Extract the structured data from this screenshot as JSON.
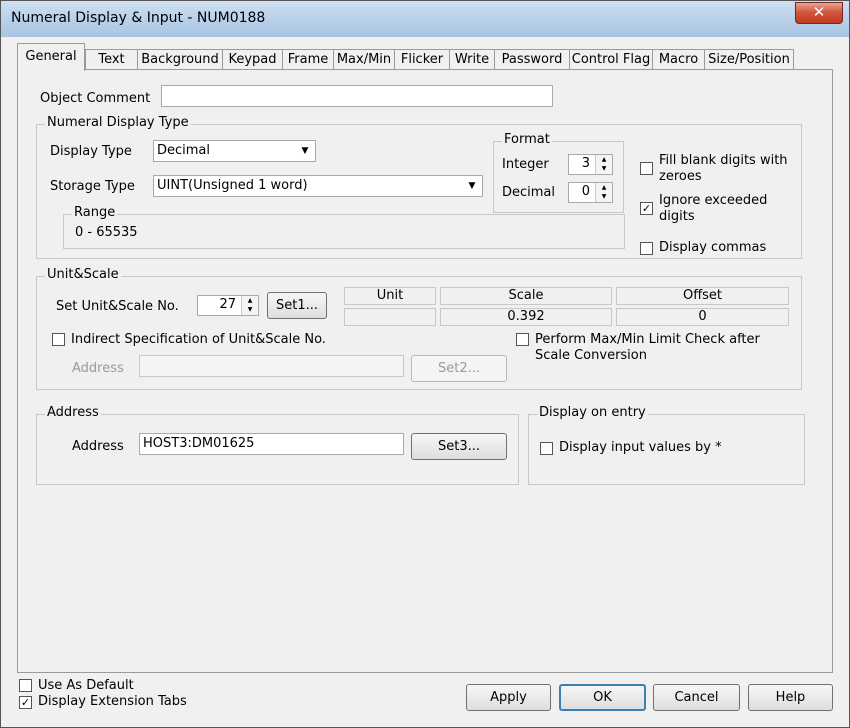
{
  "window": {
    "title": "Numeral Display & Input - NUM0188",
    "close_glyph": "✕"
  },
  "tabs": [
    "General",
    "Text",
    "Background",
    "Keypad",
    "Frame",
    "Max/Min",
    "Flicker",
    "Write",
    "Password",
    "Control Flag",
    "Macro",
    "Size/Position"
  ],
  "general": {
    "object_comment_label": "Object Comment",
    "object_comment_value": "",
    "numeral_display_type": {
      "title": "Numeral Display Type",
      "display_type_label": "Display Type",
      "display_type_value": "Decimal",
      "storage_type_label": "Storage Type",
      "storage_type_value": "UINT(Unsigned 1 word)",
      "range_title": "Range",
      "range_value": "0 - 65535",
      "format_title": "Format",
      "integer_label": "Integer",
      "integer_value": "3",
      "decimal_label": "Decimal",
      "decimal_value": "0",
      "fill_blank_label_1": "Fill blank digits with",
      "fill_blank_label_2": "zeroes",
      "fill_blank_checked": false,
      "ignore_exceeded_label_1": "Ignore exceeded",
      "ignore_exceeded_label_2": "digits",
      "ignore_exceeded_checked": true,
      "display_commas_label": "Display commas",
      "display_commas_checked": false
    },
    "unit_scale": {
      "title": "Unit&Scale",
      "set_no_label": "Set Unit&Scale No.",
      "set_no_value": "27",
      "set1_label": "Set1...",
      "headers": [
        "Unit",
        "Scale",
        "Offset"
      ],
      "values": [
        "",
        "0.392",
        "0"
      ],
      "indirect_label": "Indirect Specification of Unit&Scale No.",
      "indirect_checked": false,
      "address_label": "Address",
      "address_value": "",
      "set2_label": "Set2...",
      "perform_check_label_1": "Perform Max/Min Limit Check after",
      "perform_check_label_2": "Scale Conversion",
      "perform_check_checked": false
    },
    "address": {
      "title": "Address",
      "label": "Address",
      "value": "HOST3:DM01625",
      "set3_label": "Set3..."
    },
    "display_on_entry": {
      "title": "Display on entry",
      "label": "Display input values by *",
      "checked": false
    }
  },
  "footer": {
    "use_as_default_label": "Use As Default",
    "use_as_default_checked": false,
    "display_ext_tabs_label": "Display Extension Tabs",
    "display_ext_tabs_checked": true,
    "apply_label": "Apply",
    "ok_label": "OK",
    "cancel_label": "Cancel",
    "help_label": "Help"
  },
  "icons": {
    "check": "✓",
    "dropdown": "▼",
    "spin_up": "▲",
    "spin_down": "▼"
  }
}
